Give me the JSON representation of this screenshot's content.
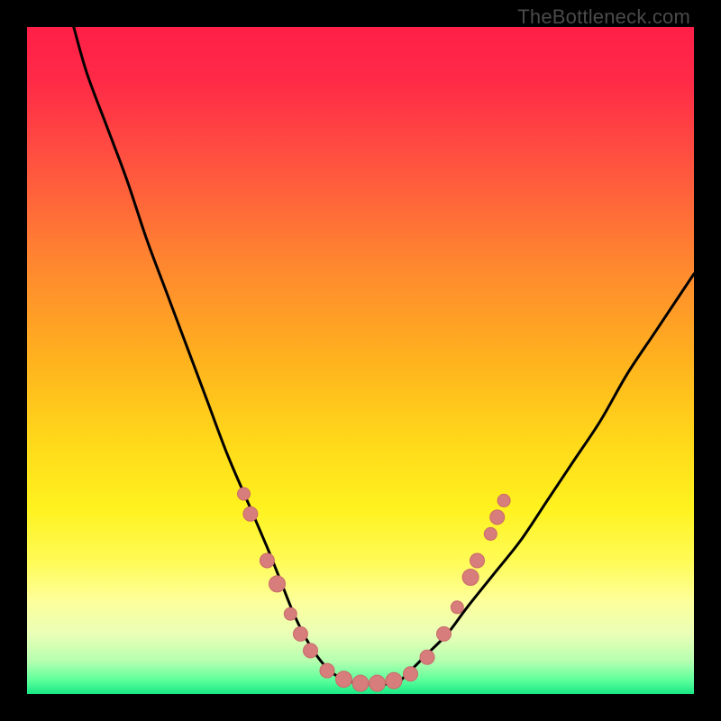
{
  "watermark": "TheBottleneck.com",
  "colors": {
    "frame": "#000000",
    "watermark": "#4a4a4a",
    "curve": "#000000",
    "marker_fill": "#d77d7b",
    "marker_stroke": "#c96a69",
    "gradient_stops": [
      {
        "offset": 0.0,
        "color": "#ff1f47"
      },
      {
        "offset": 0.08,
        "color": "#ff2a47"
      },
      {
        "offset": 0.2,
        "color": "#ff5140"
      },
      {
        "offset": 0.35,
        "color": "#ff8530"
      },
      {
        "offset": 0.5,
        "color": "#ffb21e"
      },
      {
        "offset": 0.62,
        "color": "#ffd81a"
      },
      {
        "offset": 0.72,
        "color": "#fff21e"
      },
      {
        "offset": 0.8,
        "color": "#fffb55"
      },
      {
        "offset": 0.86,
        "color": "#fdff9a"
      },
      {
        "offset": 0.91,
        "color": "#eaffb7"
      },
      {
        "offset": 0.95,
        "color": "#b7ffb0"
      },
      {
        "offset": 0.98,
        "color": "#5bff9b"
      },
      {
        "offset": 1.0,
        "color": "#18e884"
      }
    ]
  },
  "chart_data": {
    "type": "line",
    "title": "",
    "xlabel": "",
    "ylabel": "",
    "xlim": [
      0,
      100
    ],
    "ylim": [
      0,
      100
    ],
    "grid": false,
    "series": [
      {
        "name": "left-curve",
        "x": [
          7,
          9,
          12,
          15,
          18,
          21,
          24,
          27,
          30,
          33,
          36,
          38,
          40,
          42,
          44,
          46,
          48
        ],
        "values": [
          100,
          93,
          85,
          77,
          68,
          60,
          52,
          44,
          36,
          29,
          22,
          17,
          12,
          8,
          5,
          3,
          2
        ]
      },
      {
        "name": "valley-floor",
        "x": [
          48,
          50,
          52,
          54,
          56
        ],
        "values": [
          2,
          1.5,
          1.5,
          1.5,
          2
        ]
      },
      {
        "name": "right-curve",
        "x": [
          56,
          58,
          60,
          63,
          66,
          70,
          74,
          78,
          82,
          86,
          90,
          94,
          98,
          100
        ],
        "values": [
          2,
          4,
          6,
          9,
          13,
          18,
          23,
          29,
          35,
          41,
          48,
          54,
          60,
          63
        ]
      }
    ],
    "markers": [
      {
        "x": 32.5,
        "y": 30,
        "r": 7
      },
      {
        "x": 33.5,
        "y": 27,
        "r": 8
      },
      {
        "x": 36.0,
        "y": 20,
        "r": 8
      },
      {
        "x": 37.5,
        "y": 16.5,
        "r": 9
      },
      {
        "x": 39.5,
        "y": 12,
        "r": 7
      },
      {
        "x": 41.0,
        "y": 9,
        "r": 8
      },
      {
        "x": 42.5,
        "y": 6.5,
        "r": 8
      },
      {
        "x": 45.0,
        "y": 3.5,
        "r": 8
      },
      {
        "x": 47.5,
        "y": 2.2,
        "r": 9
      },
      {
        "x": 50.0,
        "y": 1.6,
        "r": 9
      },
      {
        "x": 52.5,
        "y": 1.6,
        "r": 9
      },
      {
        "x": 55.0,
        "y": 2.0,
        "r": 9
      },
      {
        "x": 57.5,
        "y": 3.0,
        "r": 8
      },
      {
        "x": 60.0,
        "y": 5.5,
        "r": 8
      },
      {
        "x": 62.5,
        "y": 9.0,
        "r": 8
      },
      {
        "x": 64.5,
        "y": 13.0,
        "r": 7
      },
      {
        "x": 66.5,
        "y": 17.5,
        "r": 9
      },
      {
        "x": 67.5,
        "y": 20.0,
        "r": 8
      },
      {
        "x": 69.5,
        "y": 24.0,
        "r": 7
      },
      {
        "x": 70.5,
        "y": 26.5,
        "r": 8
      },
      {
        "x": 71.5,
        "y": 29.0,
        "r": 7
      }
    ]
  }
}
